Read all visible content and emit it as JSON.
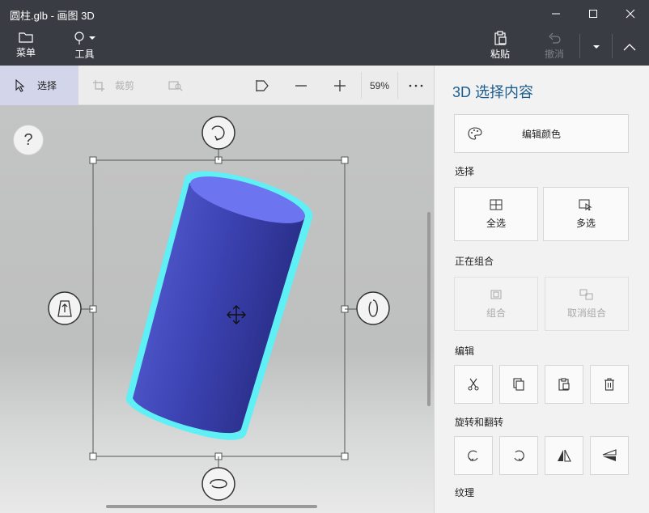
{
  "window": {
    "title": "圆柱.glb - 画图 3D"
  },
  "commandbar": {
    "menu_label": "菜单",
    "tools_label": "工具",
    "paste_label": "粘贴",
    "undo_label": "撤消"
  },
  "toolbar": {
    "select_label": "选择",
    "crop_label": "裁剪",
    "zoom_value": "59%"
  },
  "canvas": {
    "help_label": "?",
    "object": "cylinder",
    "object_color": "#4a52c8",
    "outline_color": "#5ff0f5"
  },
  "panel": {
    "title": "3D 选择内容",
    "edit_color_label": "编辑颜色",
    "select_section": "选择",
    "select_all_label": "全选",
    "multi_select_label": "多选",
    "grouping_section": "正在组合",
    "group_label": "组合",
    "ungroup_label": "取消组合",
    "edit_section": "编辑",
    "rotate_flip_section": "旋转和翻转",
    "texture_section": "纹理"
  },
  "colors": {
    "titlebar_bg": "#393c43",
    "accent_blue": "#1c5d8f",
    "select_highlight": "#d3d6ea"
  }
}
